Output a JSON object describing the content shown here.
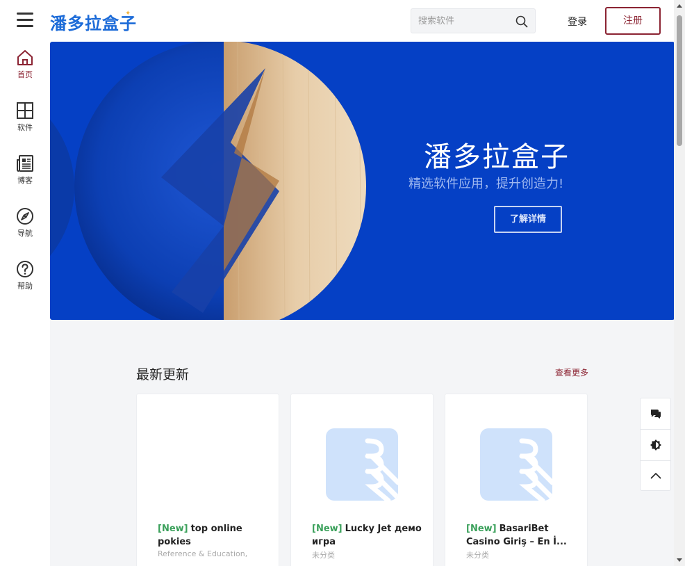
{
  "header": {
    "logo_text": "潘多拉盒子",
    "search_placeholder": "搜索软件",
    "login_label": "登录",
    "register_label": "注册"
  },
  "sidebar": {
    "items": [
      {
        "label": "首页",
        "icon": "home-icon",
        "active": true
      },
      {
        "label": "软件",
        "icon": "grid-icon",
        "active": false
      },
      {
        "label": "博客",
        "icon": "newspaper-icon",
        "active": false
      },
      {
        "label": "导航",
        "icon": "compass-icon",
        "active": false
      },
      {
        "label": "帮助",
        "icon": "help-icon",
        "active": false
      }
    ]
  },
  "banner": {
    "title": "潘多拉盒子",
    "subtitle": "精选软件应用，提升创造力!",
    "button_label": "了解详情"
  },
  "latest": {
    "title": "最新更新",
    "more_label": "查看更多",
    "cards": [
      {
        "badge": "[New]",
        "title": "top online pokies",
        "category": "Reference & Education,",
        "has_icon": false
      },
      {
        "badge": "[New]",
        "title": "Lucky Jet демо игра",
        "category": "未分类",
        "has_icon": true
      },
      {
        "badge": "[New]",
        "title": "BasariBet Casino Giriş – En İ...",
        "category": "未分类",
        "has_icon": true
      }
    ]
  },
  "float_tools": [
    "chat-icon",
    "theme-toggle-icon",
    "back-to-top-icon"
  ],
  "colors": {
    "brand": "#8b2332",
    "banner_bg": "#0540c5",
    "new_badge": "#3aa05a",
    "logo": "#1c6bd8"
  }
}
